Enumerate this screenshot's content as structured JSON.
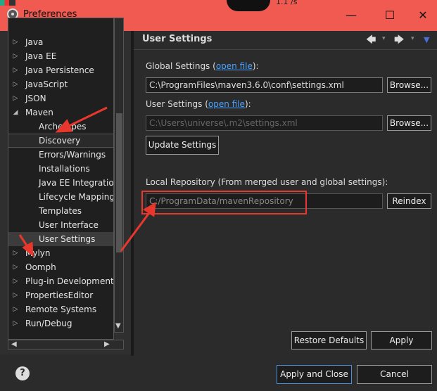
{
  "window": {
    "title": "Preferences",
    "minimize": "—",
    "maximize": "☐",
    "close": "✕",
    "overlay_text": "1.1 /s"
  },
  "tree": {
    "items": [
      {
        "label": "Java",
        "twisty": "▷"
      },
      {
        "label": "Java EE",
        "twisty": "▷"
      },
      {
        "label": "Java Persistence",
        "twisty": "▷"
      },
      {
        "label": "JavaScript",
        "twisty": "▷"
      },
      {
        "label": "JSON",
        "twisty": "▷"
      },
      {
        "label": "Maven",
        "twisty": "◢"
      },
      {
        "label": "Archetypes",
        "twisty": ""
      },
      {
        "label": "Discovery",
        "twisty": ""
      },
      {
        "label": "Errors/Warnings",
        "twisty": ""
      },
      {
        "label": "Installations",
        "twisty": ""
      },
      {
        "label": "Java EE Integration",
        "twisty": ""
      },
      {
        "label": "Lifecycle Mappings",
        "twisty": ""
      },
      {
        "label": "Templates",
        "twisty": ""
      },
      {
        "label": "User Interface",
        "twisty": ""
      },
      {
        "label": "User Settings",
        "twisty": ""
      },
      {
        "label": "Mylyn",
        "twisty": "▷"
      },
      {
        "label": "Oomph",
        "twisty": "▷"
      },
      {
        "label": "Plug-in Development",
        "twisty": "▷"
      },
      {
        "label": "PropertiesEditor",
        "twisty": "▷"
      },
      {
        "label": "Remote Systems",
        "twisty": "▷"
      },
      {
        "label": "Run/Debug",
        "twisty": "▷"
      }
    ]
  },
  "page": {
    "title": "User Settings",
    "back": "🡄",
    "forward": "🡆",
    "dropdown": "▾",
    "menu": "▼"
  },
  "global": {
    "label": "Global Settings (",
    "link": "open file",
    "label_end": "):",
    "path": "C:\\ProgramFiles\\maven3.6.0\\conf\\settings.xml",
    "browse": "Browse..."
  },
  "user": {
    "label": "User Settings (",
    "link": "open file",
    "label_end": "):",
    "path": "C:\\Users\\universe\\.m2\\settings.xml",
    "browse": "Browse..."
  },
  "update_button": "Update Settings",
  "local": {
    "label": "Local Repository (From merged user and global settings):",
    "path": "C:/ProgramData/mavenRepository",
    "reindex": "Reindex"
  },
  "actions": {
    "restore": "Restore Defaults",
    "apply": "Apply",
    "apply_close": "Apply and Close",
    "cancel": "Cancel",
    "help": "?"
  },
  "scroll": {
    "up": "▲",
    "down": "▼",
    "left": "◀",
    "right": "▶"
  },
  "colors": {
    "titlebar": "#f05a50",
    "annotation": "#e8382d",
    "link": "#4aa3ff"
  }
}
